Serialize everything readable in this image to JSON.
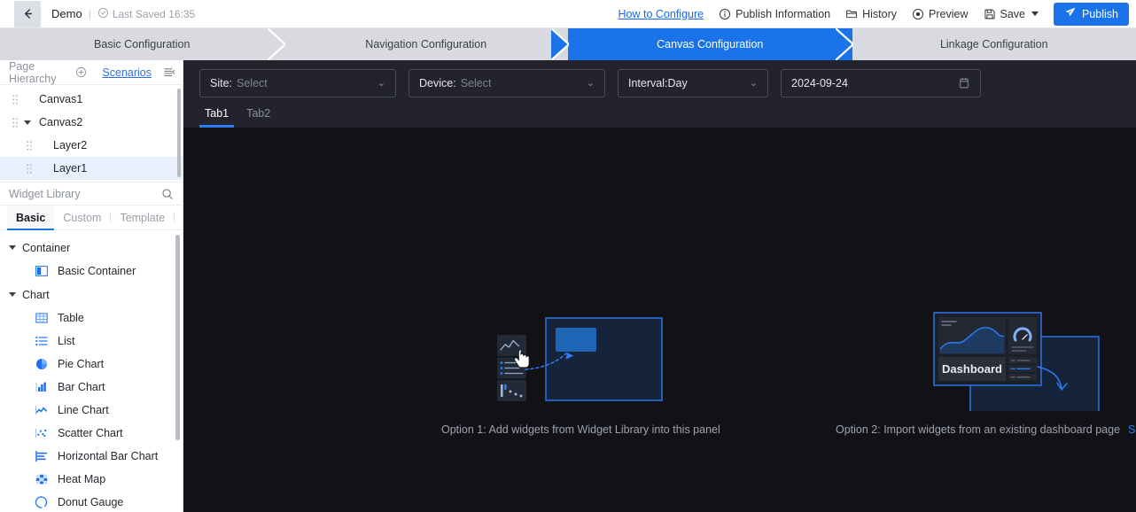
{
  "topbar": {
    "back_icon": "arrow-left-icon",
    "title": "Demo",
    "separator": "|",
    "saved_icon": "clock-check-icon",
    "saved_text": "Last Saved 16:35",
    "how_to_configure": "How to Configure",
    "publish_information": "Publish Information",
    "history": "History",
    "preview": "Preview",
    "save": "Save",
    "publish": "Publish",
    "publish_bg": "#1a73e8"
  },
  "steps": {
    "items": [
      {
        "label": "Basic Configuration",
        "active": false
      },
      {
        "label": "Navigation Configuration",
        "active": false
      },
      {
        "label": "Canvas Configuration",
        "active": true
      },
      {
        "label": "Linkage Configuration",
        "active": false
      }
    ],
    "active_color": "#1a73e8",
    "inactive_bg": "#d8dae0"
  },
  "sidebar": {
    "page_hierarchy": {
      "title": "Page Hierarchy",
      "add_icon": "plus-circle-icon",
      "scenarios": "Scenarios",
      "list_icon": "list-collapse-icon"
    },
    "tree": [
      {
        "label": "Canvas1",
        "level": 0,
        "expandable": false,
        "selected": false
      },
      {
        "label": "Canvas2",
        "level": 0,
        "expandable": true,
        "selected": false
      },
      {
        "label": "Layer2",
        "level": 1,
        "expandable": false,
        "selected": false
      },
      {
        "label": "Layer1",
        "level": 1,
        "expandable": false,
        "selected": true
      }
    ],
    "widget_library": {
      "title": "Widget Library",
      "search_icon": "search-icon",
      "tabs": [
        {
          "label": "Basic",
          "active": true
        },
        {
          "label": "Custom",
          "active": false
        },
        {
          "label": "Template",
          "active": false
        }
      ],
      "groups": [
        {
          "name": "Container",
          "items": [
            {
              "label": "Basic Container",
              "icon": "container-icon"
            }
          ]
        },
        {
          "name": "Chart",
          "items": [
            {
              "label": "Table",
              "icon": "table-icon"
            },
            {
              "label": "List",
              "icon": "list-icon"
            },
            {
              "label": "Pie Chart",
              "icon": "pie-chart-icon"
            },
            {
              "label": "Bar Chart",
              "icon": "bar-chart-icon"
            },
            {
              "label": "Line Chart",
              "icon": "line-chart-icon"
            },
            {
              "label": "Scatter Chart",
              "icon": "scatter-chart-icon"
            },
            {
              "label": "Horizontal Bar Chart",
              "icon": "horizontal-bar-chart-icon"
            },
            {
              "label": "Heat Map",
              "icon": "heat-map-icon"
            },
            {
              "label": "Donut Gauge",
              "icon": "donut-gauge-icon"
            }
          ]
        }
      ]
    }
  },
  "canvas": {
    "filters": {
      "site": {
        "label": "Site:",
        "placeholder": "Select",
        "arrow": "chevron-down-icon"
      },
      "device": {
        "label": "Device:",
        "placeholder": "Select",
        "arrow": "chevron-down-icon"
      },
      "interval": {
        "label": "Interval:Day",
        "arrow": "chevron-down-icon"
      },
      "date": {
        "value": "2024-09-24",
        "icon": "calendar-icon"
      }
    },
    "tabs": [
      {
        "label": "Tab1",
        "active": true
      },
      {
        "label": "Tab2",
        "active": false
      }
    ],
    "option1": {
      "caption": "Option 1: Add widgets from Widget Library into this panel"
    },
    "option2": {
      "caption": "Option 2: Import widgets from an existing dashboard page",
      "link": "Select Dashboard",
      "dashboard_label": "Dashboard"
    },
    "background": "#111116",
    "filterbar_background": "#23232d",
    "accent": "#2b7cf5"
  }
}
